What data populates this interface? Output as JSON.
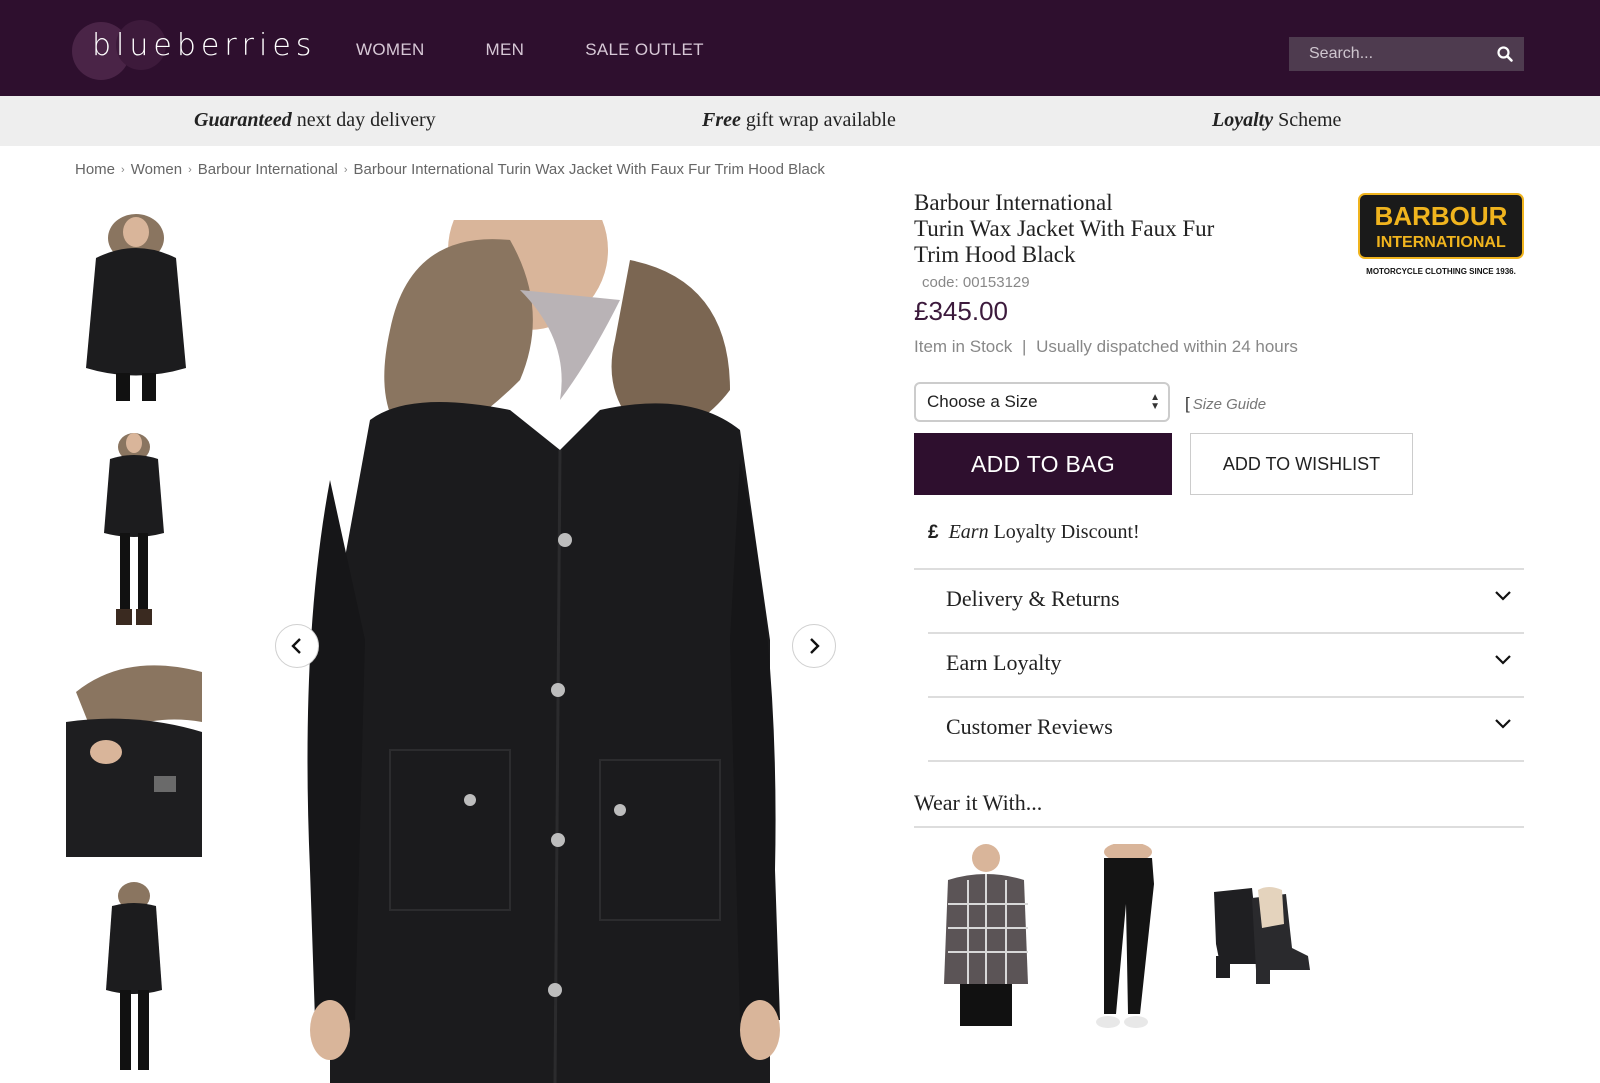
{
  "header": {
    "logo_text": "blueberries",
    "nav": [
      "WOMEN",
      "MEN",
      "SALE OUTLET"
    ],
    "search_placeholder": "Search..."
  },
  "promo": [
    {
      "bold": "Guaranteed",
      "rest": " next day delivery"
    },
    {
      "bold": "Free",
      "rest": " gift wrap available"
    },
    {
      "bold": "Loyalty",
      "rest": " Scheme"
    }
  ],
  "breadcrumb": [
    "Home",
    "Women",
    "Barbour International",
    "Barbour International Turin Wax Jacket With Faux Fur Trim Hood Black"
  ],
  "product": {
    "title_lines": [
      "Barbour International",
      "Turin Wax Jacket With Faux Fur",
      "Trim Hood Black"
    ],
    "code": "code: 00153129",
    "price": "£345.00",
    "stock": "Item in Stock",
    "dispatch": "Usually dispatched within 24 hours",
    "size_select": "Choose a Size",
    "size_guide": "Size Guide",
    "add_to_bag": "ADD TO BAG",
    "add_to_wishlist": "ADD TO WISHLIST",
    "loyalty_symbol": "£",
    "loyalty_italic": "Earn",
    "loyalty_rest": " Loyalty Discount!"
  },
  "brand_logo": {
    "line1": "BARBOUR",
    "line2": "INTERNATIONAL",
    "tagline": "MOTORCYCLE CLOTHING SINCE 1936."
  },
  "accordion": [
    "Delivery & Returns",
    "Earn Loyalty",
    "Customer Reviews"
  ],
  "wear_it_with": {
    "title": "Wear it With..."
  },
  "colors": {
    "header_bg": "#2e0f2e",
    "accent": "#3c1a3c",
    "promo_bg": "#eeeeee",
    "brand_logo_bg": "#1a1a1a",
    "brand_logo_gold": "#f0b41e"
  }
}
